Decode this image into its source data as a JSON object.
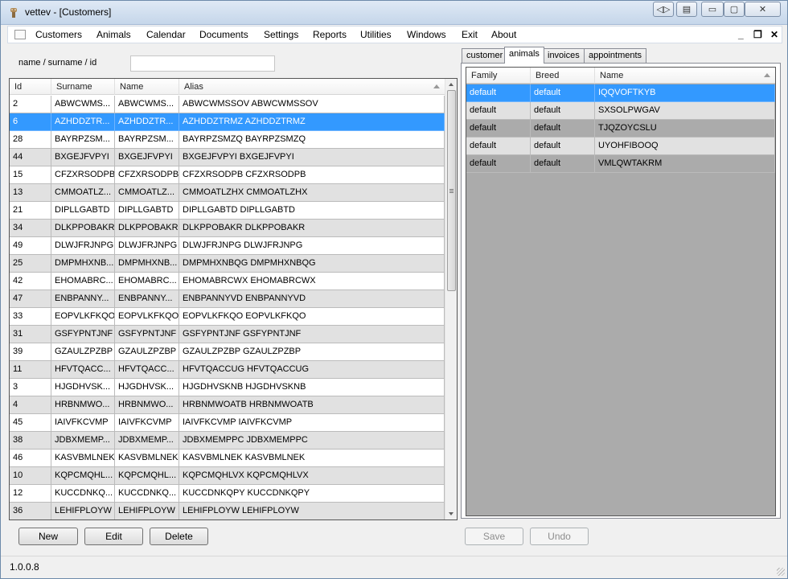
{
  "window": {
    "title": "vettev - [Customers]"
  },
  "menu": {
    "items": [
      "Customers",
      "Animals",
      "Calendar",
      "Documents",
      "Settings",
      "Reports",
      "Utilities",
      "Windows",
      "Exit",
      "About"
    ],
    "mdi_min": "_",
    "mdi_restore": "❐",
    "mdi_close": "✕"
  },
  "search": {
    "label": "name / surname / id",
    "value": ""
  },
  "customers": {
    "columns": [
      "Id",
      "Surname",
      "Name",
      "Alias"
    ],
    "selected_index": 1,
    "rows": [
      [
        "2",
        "ABWCWMS...",
        "ABWCWMS...",
        "ABWCWMSSOV ABWCWMSSOV"
      ],
      [
        "6",
        "AZHDDZTR...",
        "AZHDDZTR...",
        "AZHDDZTRMZ AZHDDZTRMZ"
      ],
      [
        "28",
        "BAYRPZSM...",
        "BAYRPZSM...",
        "BAYRPZSMZQ BAYRPZSMZQ"
      ],
      [
        "44",
        "BXGEJFVPYI",
        "BXGEJFVPYI",
        "BXGEJFVPYI BXGEJFVPYI"
      ],
      [
        "15",
        "CFZXRSODPB",
        "CFZXRSODPB",
        "CFZXRSODPB CFZXRSODPB"
      ],
      [
        "13",
        "CMMOATLZ...",
        "CMMOATLZ...",
        "CMMOATLZHX CMMOATLZHX"
      ],
      [
        "21",
        "DIPLLGABTD",
        "DIPLLGABTD",
        "DIPLLGABTD DIPLLGABTD"
      ],
      [
        "34",
        "DLKPPOBAKR",
        "DLKPPOBAKR",
        "DLKPPOBAKR DLKPPOBAKR"
      ],
      [
        "49",
        "DLWJFRJNPG",
        "DLWJFRJNPG",
        "DLWJFRJNPG DLWJFRJNPG"
      ],
      [
        "25",
        "DMPMHXNB...",
        "DMPMHXNB...",
        "DMPMHXNBQG DMPMHXNBQG"
      ],
      [
        "42",
        "EHOMABRC...",
        "EHOMABRC...",
        "EHOMABRCWX EHOMABRCWX"
      ],
      [
        "47",
        "ENBPANNY...",
        "ENBPANNY...",
        "ENBPANNYVD ENBPANNYVD"
      ],
      [
        "33",
        "EOPVLKFKQO",
        "EOPVLKFKQO",
        "EOPVLKFKQO EOPVLKFKQO"
      ],
      [
        "31",
        "GSFYPNTJNF",
        "GSFYPNTJNF",
        "GSFYPNTJNF GSFYPNTJNF"
      ],
      [
        "39",
        "GZAULZPZBP",
        "GZAULZPZBP",
        "GZAULZPZBP GZAULZPZBP"
      ],
      [
        "11",
        "HFVTQACC...",
        "HFVTQACC...",
        "HFVTQACCUG HFVTQACCUG"
      ],
      [
        "3",
        "HJGDHVSK...",
        "HJGDHVSK...",
        "HJGDHVSKNB HJGDHVSKNB"
      ],
      [
        "4",
        "HRBNMWO...",
        "HRBNMWO...",
        "HRBNMWOATB HRBNMWOATB"
      ],
      [
        "45",
        "IAIVFKCVMP",
        "IAIVFKCVMP",
        "IAIVFKCVMP IAIVFKCVMP"
      ],
      [
        "38",
        "JDBXMEMP...",
        "JDBXMEMP...",
        "JDBXMEMPPC JDBXMEMPPC"
      ],
      [
        "46",
        "KASVBMLNEK",
        "KASVBMLNEK",
        "KASVBMLNEK KASVBMLNEK"
      ],
      [
        "10",
        "KQPCMQHL...",
        "KQPCMQHL...",
        "KQPCMQHLVX KQPCMQHLVX"
      ],
      [
        "12",
        "KUCCDNKQ...",
        "KUCCDNKQ...",
        "KUCCDNKQPY KUCCDNKQPY"
      ],
      [
        "36",
        "LEHIFPLOYW",
        "LEHIFPLOYW",
        "LEHIFPLOYW LEHIFPLOYW"
      ]
    ]
  },
  "buttons": {
    "new": "New",
    "edit": "Edit",
    "delete": "Delete",
    "save": "Save",
    "undo": "Undo"
  },
  "tabs": {
    "items": [
      "customer",
      "animals",
      "invoices",
      "appointments"
    ],
    "active": "animals"
  },
  "animals": {
    "columns": [
      "Family",
      "Breed",
      "Name"
    ],
    "selected_index": 0,
    "rows": [
      [
        "default",
        "default",
        "IQQVOFTKYB"
      ],
      [
        "default",
        "default",
        "SXSOLPWGAV"
      ],
      [
        "default",
        "default",
        "TJQZOYCSLU"
      ],
      [
        "default",
        "default",
        "UYOHFIBOOQ"
      ],
      [
        "default",
        "default",
        "VMLQWTAKRM"
      ]
    ]
  },
  "status": {
    "version": "1.0.0.8"
  },
  "colors": {
    "selection": "#3399ff",
    "alt_row": "#e1e1e1",
    "empty_grid": "#ababab"
  }
}
